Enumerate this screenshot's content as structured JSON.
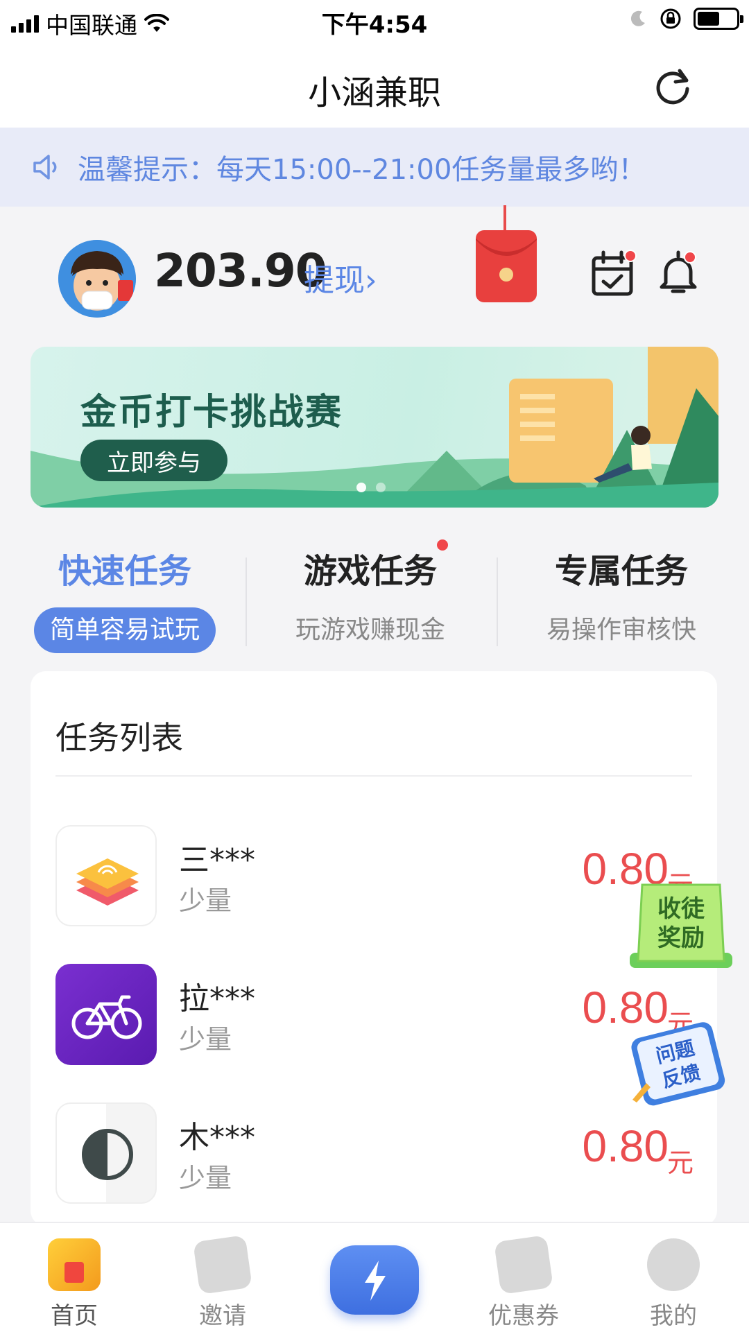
{
  "status_bar": {
    "carrier": "中国联通",
    "time": "下午4:54"
  },
  "header": {
    "title": "小涵兼职"
  },
  "notice": {
    "text": "温馨提示：每天15:00--21:00任务量最多哟！"
  },
  "user": {
    "balance": "203.90",
    "withdraw_label": "提现›"
  },
  "banner": {
    "title": "金币打卡挑战赛",
    "button_label": "立即参与",
    "active_slide": 1,
    "slide_count": 2
  },
  "categories": [
    {
      "title": "快速任务",
      "subtitle": "简单容易试玩",
      "active": true,
      "has_dot": false
    },
    {
      "title": "游戏任务",
      "subtitle": "玩游戏赚现金",
      "active": false,
      "has_dot": true
    },
    {
      "title": "专属任务",
      "subtitle": "易操作审核快",
      "active": false,
      "has_dot": false
    }
  ],
  "task_list": {
    "title": "任务列表",
    "items": [
      {
        "name": "三***",
        "tag": "少量",
        "price": "0.80",
        "unit": "元",
        "icon": "layers-app-icon"
      },
      {
        "name": "拉***",
        "tag": "少量",
        "price": "0.80",
        "unit": "元",
        "icon": "bicycle-app-icon"
      },
      {
        "name": "木***",
        "tag": "少量",
        "price": "0.80",
        "unit": "元",
        "icon": "half-circle-app-icon"
      }
    ]
  },
  "floating": {
    "reward_label": "收徒奖励",
    "feedback_label": "问题反馈"
  },
  "tabbar": [
    {
      "label": "首页",
      "icon": "home-icon",
      "active": true
    },
    {
      "label": "邀请",
      "icon": "invite-icon",
      "active": false
    },
    {
      "label": "",
      "icon": "lightning-icon",
      "active": false
    },
    {
      "label": "优惠券",
      "icon": "coupon-icon",
      "active": false
    },
    {
      "label": "我的",
      "icon": "profile-icon",
      "active": false
    }
  ],
  "colors": {
    "accent": "#5b86e5",
    "price": "#ea4d4f",
    "banner_dark": "#1f5e4c",
    "notice_bg": "#e8ebf8"
  }
}
